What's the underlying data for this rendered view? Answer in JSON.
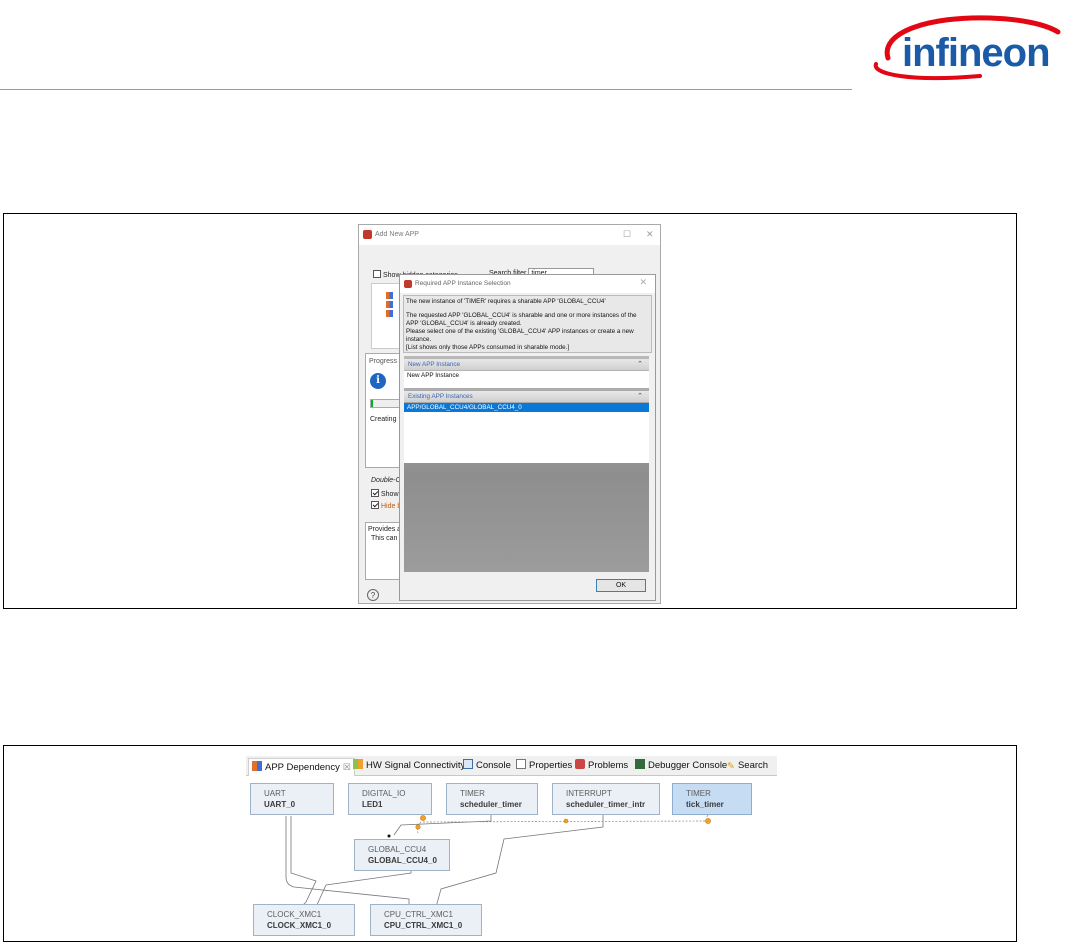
{
  "brand": {
    "name": "infineon",
    "color": "#1a5aa6",
    "accent": "#e30613"
  },
  "fig1": {
    "add_dialog": {
      "title": "Add New APP",
      "show_hidden": "Show hidden categories",
      "search_label": "Search filter",
      "search_value": "timer",
      "double_click": "Double-C",
      "show_label": "Show",
      "hide_label": "Hide b",
      "desc_1": "Provides an",
      "desc_2": "This can b",
      "help": "?"
    },
    "progress": {
      "title": "Progress",
      "creating": "Creating"
    },
    "req_dialog": {
      "title": "Required APP Instance Selection",
      "message": [
        "The new instance of 'TIMER' requires a sharable APP 'GLOBAL_CCU4'",
        "",
        "The requested APP 'GLOBAL_CCU4' is sharable and one or more instances of the",
        "APP 'GLOBAL_CCU4' is already created.",
        "Please select one of the existing 'GLOBAL_CCU4' APP instances or create a new",
        "instance.",
        "[List shows only those APPs consumed in sharable mode.]"
      ],
      "new_section": "New APP Instance",
      "new_item": "New APP Instance",
      "existing_section": "Existing APP Instances",
      "existing_item": "APP/GLOBAL_CCU4/GLOBAL_CCU4_0",
      "ok": "OK"
    }
  },
  "fig2": {
    "tabs": [
      {
        "label": "APP Dependency",
        "icon": "app-icon",
        "active": true
      },
      {
        "label": "HW Signal Connectivity",
        "icon": "hw-signal-icon"
      },
      {
        "label": "Console",
        "icon": "console-icon"
      },
      {
        "label": "Properties",
        "icon": "properties-icon"
      },
      {
        "label": "Problems",
        "icon": "problems-icon"
      },
      {
        "label": "Debugger Console",
        "icon": "debugger-console-icon"
      },
      {
        "label": "Search",
        "icon": "search-icon"
      }
    ],
    "nodes": [
      {
        "type": "UART",
        "name": "UART_0"
      },
      {
        "type": "DIGITAL_IO",
        "name": "LED1"
      },
      {
        "type": "TIMER",
        "name": "scheduler_timer"
      },
      {
        "type": "INTERRUPT",
        "name": "scheduler_timer_intr"
      },
      {
        "type": "TIMER",
        "name": "tick_timer"
      },
      {
        "type": "GLOBAL_CCU4",
        "name": "GLOBAL_CCU4_0"
      },
      {
        "type": "CLOCK_XMC1",
        "name": "CLOCK_XMC1_0"
      },
      {
        "type": "CPU_CTRL_XMC1",
        "name": "CPU_CTRL_XMC1_0"
      }
    ]
  }
}
